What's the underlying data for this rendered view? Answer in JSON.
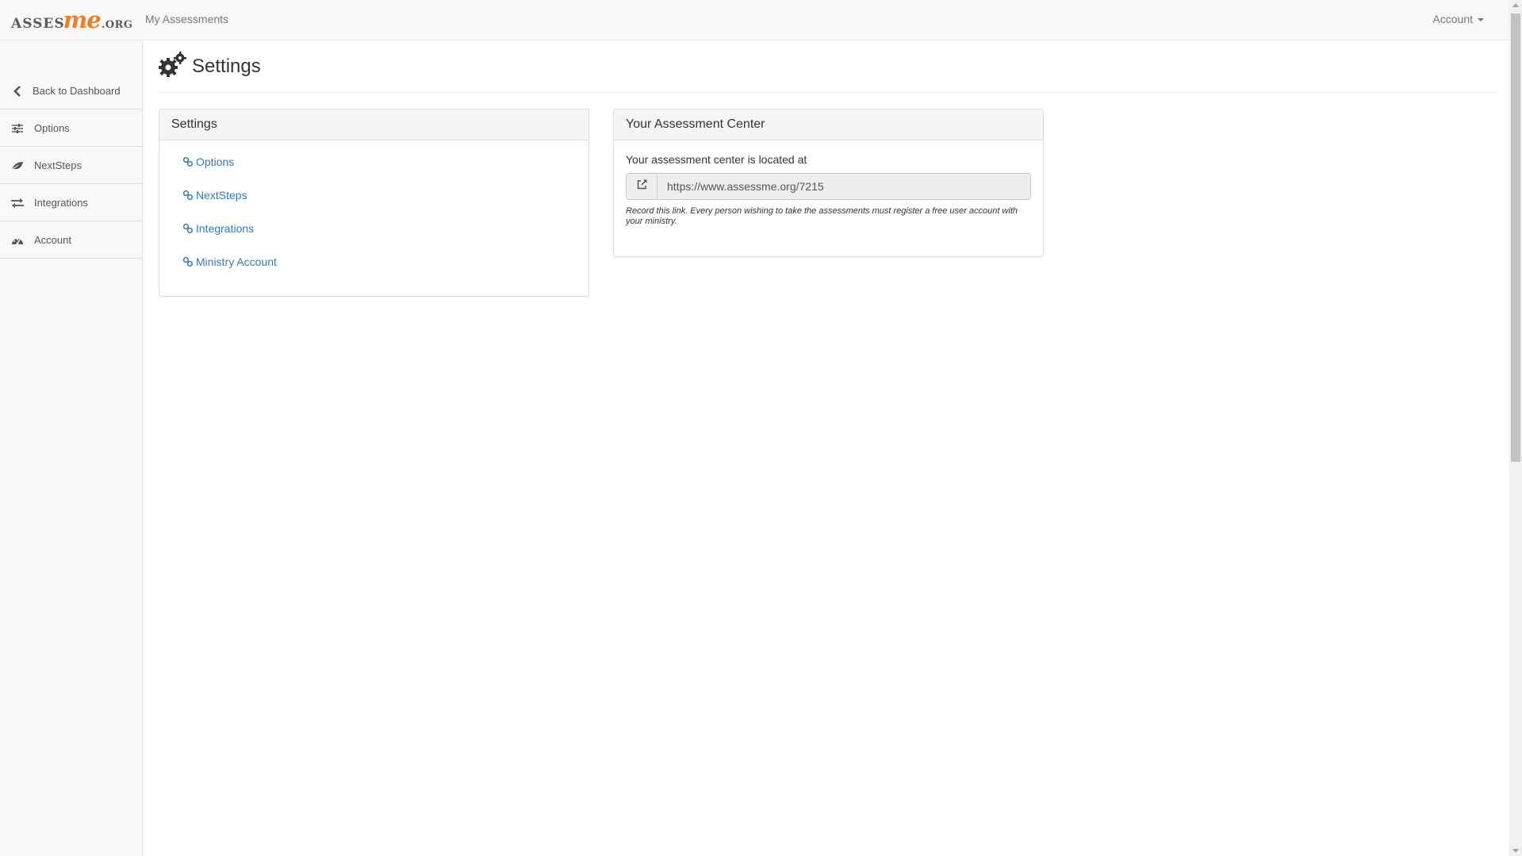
{
  "navbar": {
    "brand": {
      "part1": "ASSES",
      "part2": "me",
      "part3": ".ORG"
    },
    "my_assessments": "My Assessments",
    "account": "Account"
  },
  "sidebar": {
    "back": {
      "label": "Back to Dashboard",
      "icon": "chevron-left-icon"
    },
    "items": [
      {
        "label": "Options",
        "icon": "sliders-icon"
      },
      {
        "label": "NextSteps",
        "icon": "leaf-icon"
      },
      {
        "label": "Integrations",
        "icon": "exchange-icon"
      },
      {
        "label": "Account",
        "icon": "dashboard-icon"
      }
    ]
  },
  "page": {
    "title": "Settings",
    "title_icon": "gears-icon"
  },
  "settings_panel": {
    "heading": "Settings",
    "links": [
      {
        "label": "Options",
        "icon": "link-icon"
      },
      {
        "label": "NextSteps",
        "icon": "link-icon"
      },
      {
        "label": "Integrations",
        "icon": "link-icon"
      },
      {
        "label": "Ministry Account",
        "icon": "link-icon"
      }
    ]
  },
  "center_panel": {
    "heading": "Your Assessment Center",
    "located_text": "Your assessment center is located at",
    "url": "https://www.assessme.org/7215",
    "help": "Record this link. Every person wishing to take the assessments must register a free user account with your ministry.",
    "addon_icon": "external-link-icon"
  },
  "colors": {
    "link": "#337ab7",
    "brand_orange": "#f07c23",
    "navbar_bg": "#f8f8f8"
  }
}
